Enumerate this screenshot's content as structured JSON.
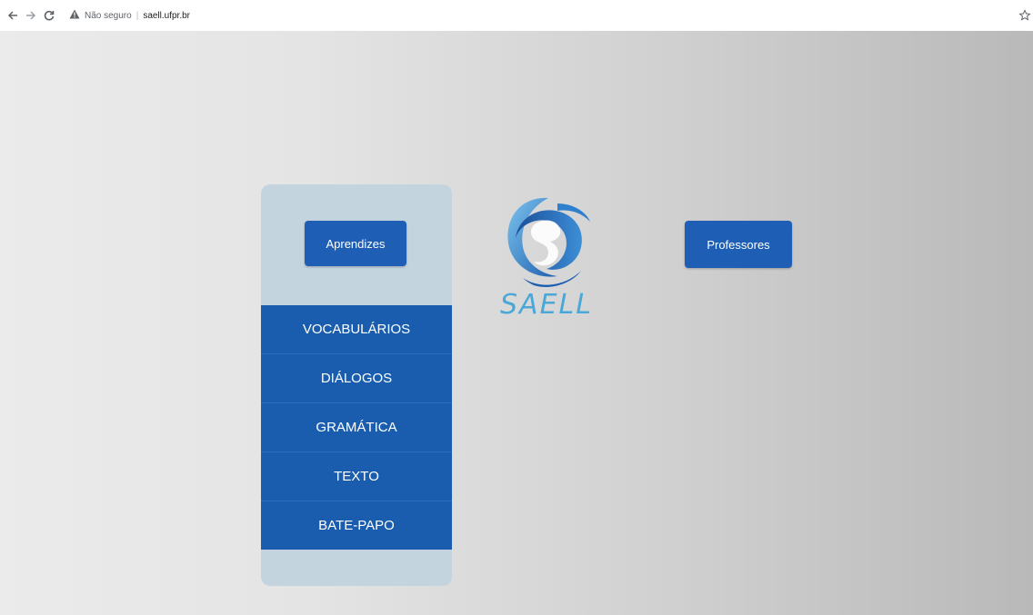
{
  "browser": {
    "security_text": "Não seguro",
    "url": "saell.ufpr.br"
  },
  "panel": {
    "aprendizes_label": "Aprendizes",
    "menu": [
      {
        "label": "VOCABULÁRIOS"
      },
      {
        "label": "DIÁLOGOS"
      },
      {
        "label": "GRAMÁTICA"
      },
      {
        "label": "TEXTO"
      },
      {
        "label": "BATE-PAPO"
      }
    ]
  },
  "logo": {
    "text": "SAELL",
    "icon": "saell-logo-icon"
  },
  "professores_label": "Professores",
  "colors": {
    "button_blue": "#1e5fb5",
    "panel_bg": "#c3d4df",
    "logo_blue": "#4aa8d8"
  }
}
